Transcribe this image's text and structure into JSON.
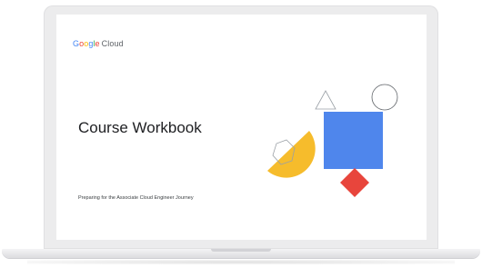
{
  "brand": {
    "google_letters": [
      "G",
      "o",
      "o",
      "g",
      "l",
      "e"
    ],
    "product": "Cloud"
  },
  "slide": {
    "title": "Course Workbook",
    "subtitle": "Preparing for the Associate Cloud Engineer Journey"
  },
  "colors": {
    "blue": "#4285f4",
    "red": "#ea4335",
    "yellow": "#fbbc05",
    "green": "#34a853",
    "square_blue": "#4f86ec",
    "diamond_red": "#e8453c",
    "semicircle_yellow": "#f6bc2c"
  },
  "decoration": {
    "shapes": [
      "triangle-outline",
      "circle-outline",
      "blue-square",
      "hexagon-outline",
      "yellow-semicircle",
      "red-diamond"
    ]
  }
}
